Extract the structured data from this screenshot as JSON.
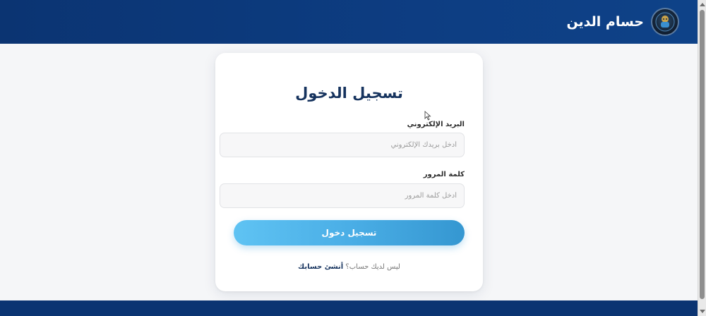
{
  "header": {
    "brand_name": "حسام الدين",
    "logo_icon": "avatar-logo-icon"
  },
  "login": {
    "title": "تسجيل الدخول",
    "email_label": "البريد الإلكتروني",
    "email_placeholder": "أدخل بريدك الإلكتروني",
    "email_value": "",
    "password_label": "كلمة المرور",
    "password_placeholder": "أدخل كلمة المرور",
    "password_value": "",
    "submit_label": "تسجيل دخول",
    "signup_prompt": "ليس لديك حساب؟",
    "signup_link": "أنشئ حسابك"
  },
  "colors": {
    "header_bg": "#0d3d82",
    "title": "#16335e",
    "button_start": "#5fc3f3",
    "button_end": "#3597d1"
  }
}
